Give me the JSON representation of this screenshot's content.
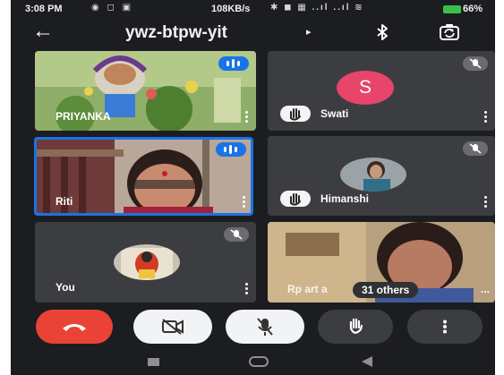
{
  "status_bar": {
    "time": "3:08 PM",
    "left_icons": "◉ ◻ ▣",
    "speed": "108KB/s",
    "right_icons": "✱ ◼ ▦ ..ıl ..ıl ≋",
    "battery": "66%"
  },
  "app_bar": {
    "back_icon": "arrow-left",
    "meeting_code": "ywz-btpw-yit",
    "caret": "▸",
    "bluetooth_icon": "bluetooth",
    "camera_switch_icon": "camera-switch"
  },
  "participants": [
    {
      "name": "PRIYANKA",
      "state": "speaking",
      "video": "drawing"
    },
    {
      "name": "Swati",
      "avatar_letter": "S",
      "state": "muted",
      "hand_raised": true
    },
    {
      "name": "Riti",
      "state": "speaking",
      "active": true
    },
    {
      "name": "Himanshi",
      "state": "muted",
      "hand_raised": true
    },
    {
      "name": "You",
      "state": "muted"
    },
    {
      "name": "Rp art a",
      "others": "31 others",
      "more": "..."
    }
  ],
  "controls": [
    {
      "name": "end-call",
      "color": "#ea4335"
    },
    {
      "name": "camera-off",
      "color": "#f1f3f4"
    },
    {
      "name": "mic-off",
      "color": "#f1f3f4"
    },
    {
      "name": "raise-hand",
      "color": "#3c3d41"
    },
    {
      "name": "more-options",
      "color": "#3c3d41"
    }
  ],
  "colors": {
    "background": "#1c1d21",
    "tile": "#3c3d41",
    "accent": "#1a73e8",
    "avatar": "#e8456a",
    "end_call": "#ea4335"
  }
}
